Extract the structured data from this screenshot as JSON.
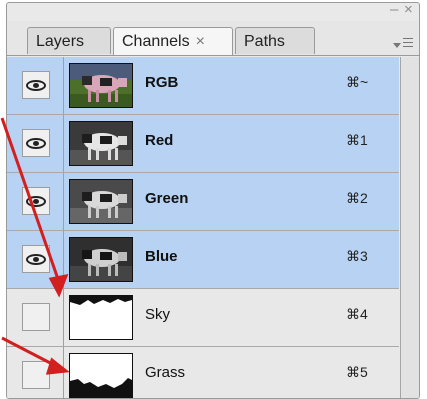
{
  "panel": {
    "tabs": [
      {
        "label": "Layers"
      },
      {
        "label": "Channels",
        "close_glyph": "×"
      },
      {
        "label": "Paths"
      }
    ],
    "window_controls": {
      "minimize": "–",
      "close": "×"
    }
  },
  "channels": [
    {
      "name": "RGB",
      "shortcut": "⌘~",
      "visible": true,
      "selected": true
    },
    {
      "name": "Red",
      "shortcut": "⌘1",
      "visible": true,
      "selected": true
    },
    {
      "name": "Green",
      "shortcut": "⌘2",
      "visible": true,
      "selected": true
    },
    {
      "name": "Blue",
      "shortcut": "⌘3",
      "visible": true,
      "selected": true
    },
    {
      "name": "Sky",
      "shortcut": "⌘4",
      "visible": false,
      "selected": false
    },
    {
      "name": "Grass",
      "shortcut": "⌘5",
      "visible": false,
      "selected": false
    }
  ],
  "colors": {
    "selected_row": "#b8d2f3",
    "annotation_arrow": "#d21f1f"
  }
}
